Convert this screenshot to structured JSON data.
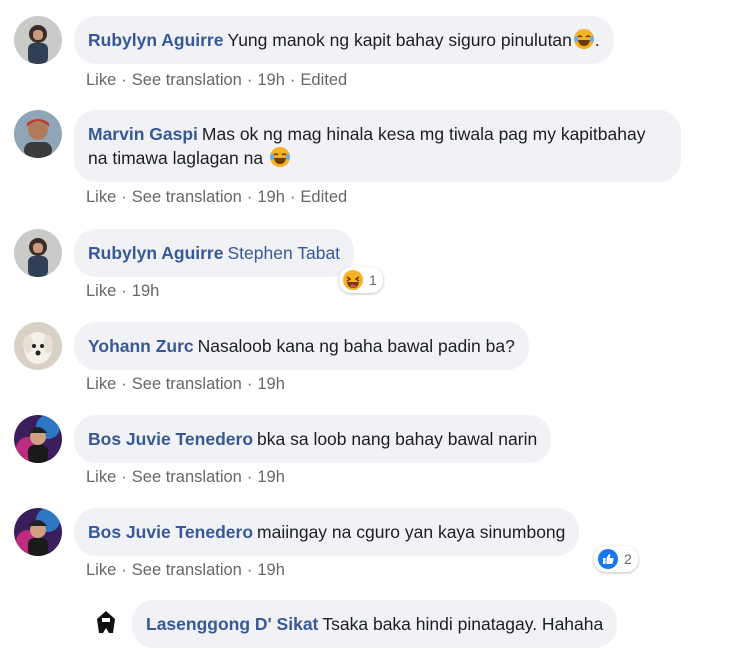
{
  "comments": [
    {
      "author": "Rubylyn Aguirre",
      "text": "Yung manok ng kapit bahay siguro pinulutan",
      "emoji": "laughing-tears-emoji",
      "text_after_emoji": ".",
      "actions": {
        "like": "Like",
        "translate": "See translation",
        "time": "19h",
        "edited": "Edited"
      }
    },
    {
      "author": "Marvin Gaspi",
      "text": "Mas ok ng mag hinala kesa mg tiwala pag my kapitbahay na timawa laglagan na",
      "emoji": "laughing-tears-emoji",
      "actions": {
        "like": "Like",
        "translate": "See translation",
        "time": "19h",
        "edited": "Edited"
      }
    },
    {
      "author": "Rubylyn Aguirre",
      "mention": "Stephen Tabat",
      "reaction": {
        "icon": "haha-reaction-icon",
        "count": "1"
      },
      "actions": {
        "like": "Like",
        "time": "19h"
      }
    },
    {
      "author": "Yohann Zurc",
      "text": "Nasaloob kana ng baha bawal padin ba?",
      "actions": {
        "like": "Like",
        "translate": "See translation",
        "time": "19h"
      }
    },
    {
      "author": "Bos Juvie Tenedero",
      "text": "bka sa loob nang bahay bawal narin",
      "actions": {
        "like": "Like",
        "translate": "See translation",
        "time": "19h"
      }
    },
    {
      "author": "Bos Juvie Tenedero",
      "text": "maiingay na cguro yan kaya sinumbong",
      "reaction": {
        "icon": "like-reaction-icon",
        "count": "2"
      },
      "actions": {
        "like": "Like",
        "translate": "See translation",
        "time": "19h"
      }
    },
    {
      "author": "Lasenggong D' Sikat",
      "text": "Tsaka baka hindi pinatagay. Hahaha"
    }
  ],
  "separator": "·",
  "colors": {
    "link": "#385898",
    "bubble": "#f0f2f5",
    "meta": "#65676b",
    "like_blue": "#1877f2",
    "haha_yellow": "#f7b125"
  }
}
